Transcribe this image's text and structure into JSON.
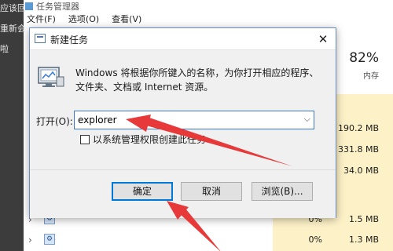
{
  "background_window": {
    "sidebar_fragments": [
      "应该回",
      "重新会",
      "啦"
    ],
    "title": "任务管理器",
    "menu": [
      "文件(F)",
      "选项(O)",
      "查看(V)"
    ],
    "memory_header": {
      "percent": "82%",
      "label": "内存"
    },
    "memory_values": [
      "190.2 MB",
      "331.8 MB",
      "34.0 MB"
    ],
    "rows": [
      {
        "chevron": "›",
        "cpu": "0%",
        "memory": "1.5 MB"
      },
      {
        "chevron": "›",
        "cpu": "0%",
        "memory": "1.3 MB"
      }
    ]
  },
  "dialog": {
    "title": "新建任务",
    "description": "Windows 将根据你所键入的名称，为你打开相应的程序、文件夹、文档或 Internet 资源。",
    "open_label": "打开(O):",
    "open_value": "explorer",
    "admin_checkbox_label": "以系统管理权限创建此任务",
    "admin_checked": false,
    "buttons": {
      "ok": "确定",
      "cancel": "取消",
      "browse": "浏览(B)..."
    }
  },
  "annotation_color": "#e8393a",
  "colors": {
    "accent": "#0078d7",
    "memory_column": "#fdf1c7"
  }
}
